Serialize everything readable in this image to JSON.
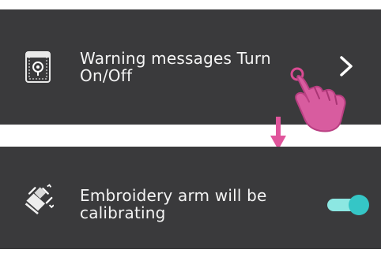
{
  "warning_item": {
    "label": "Warning messages Turn\nOn/Off",
    "icon": "warning-settings-icon",
    "action_icon": "chevron-right-icon"
  },
  "calibration_item": {
    "label": "Embroidery arm will be\ncalibrating",
    "icon": "embroidery-arm-icon",
    "toggle_state": "on"
  },
  "colors": {
    "panel_bg": "#3a3a3c",
    "text": "#f4f4f4",
    "accent_pink": "#e0559c",
    "toggle_accent": "#35c6c6"
  }
}
